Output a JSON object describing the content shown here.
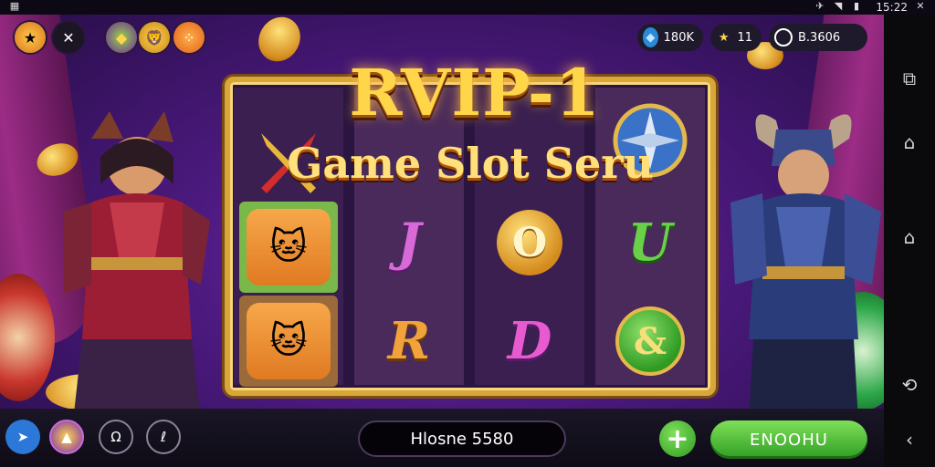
{
  "status_bar": {
    "time": "15:22"
  },
  "title": {
    "main": "RVIP-1",
    "subtitle": "Game Slot Seru"
  },
  "top_left_icons": [
    "star-badge-icon",
    "close-icon",
    "gem-icon",
    "lion-icon",
    "menu-dots-icon"
  ],
  "currencies": {
    "gems": "180K",
    "stars": "11",
    "balance": "B.3606"
  },
  "reels": [
    [
      "sword-symbol",
      "cat-symbol",
      "cat-symbol"
    ],
    [
      "J",
      "R"
    ],
    [
      "O",
      "D"
    ],
    [
      "U",
      "&"
    ]
  ],
  "bottom_bar": {
    "balance_text": "Hlosne 5580",
    "plus_label": "+",
    "spin_label": "ENOOHU"
  },
  "colors": {
    "accent_gold": "#ffd54a",
    "spin_green": "#4cbf34",
    "purple_bg": "#5a1f8e"
  }
}
